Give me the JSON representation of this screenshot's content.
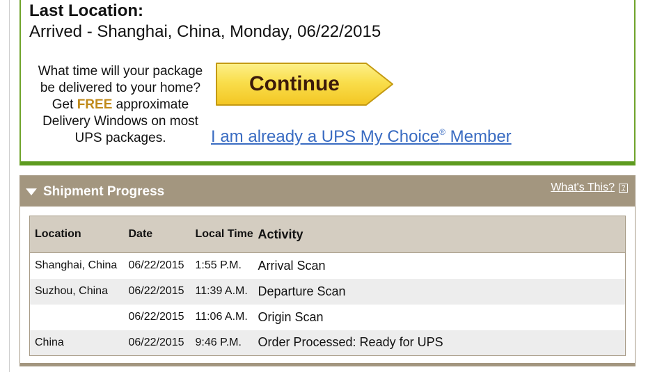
{
  "last_location": {
    "title": "Last Location:",
    "value": "Arrived - Shanghai, China, Monday, 06/22/2015"
  },
  "promo": {
    "line1": "What time will your package be delivered to your home? Get ",
    "free": "FREE",
    "line2": " approximate Delivery Windows on most UPS packages.",
    "continue_label": "Continue",
    "member_link": "I am already a UPS My Choice",
    "member_reg": "®",
    "member_suffix": " Member"
  },
  "shipment_progress": {
    "title": "Shipment Progress",
    "whats_this": "What's This?",
    "help_icon": "?",
    "columns": {
      "location": "Location",
      "date": "Date",
      "local_time": "Local Time",
      "activity": "Activity"
    },
    "rows": [
      {
        "location": "Shanghai, China",
        "date": "06/22/2015",
        "time": "1:55 P.M.",
        "activity": "Arrival Scan"
      },
      {
        "location": "Suzhou, China",
        "date": "06/22/2015",
        "time": "11:39 A.M.",
        "activity": "Departure Scan"
      },
      {
        "location": "",
        "date": "06/22/2015",
        "time": "11:06 A.M.",
        "activity": "Origin Scan"
      },
      {
        "location": "China",
        "date": "06/22/2015",
        "time": "9:46 P.M.",
        "activity": "Order Processed: Ready for UPS"
      }
    ]
  },
  "colors": {
    "panel_green": "#5d9b1f",
    "free_gold": "#c08a1a",
    "button_yellow": "#f9d84a",
    "link_blue": "#3a6cc2",
    "header_taupe": "#a3967f",
    "table_header": "#d4cdc1"
  }
}
